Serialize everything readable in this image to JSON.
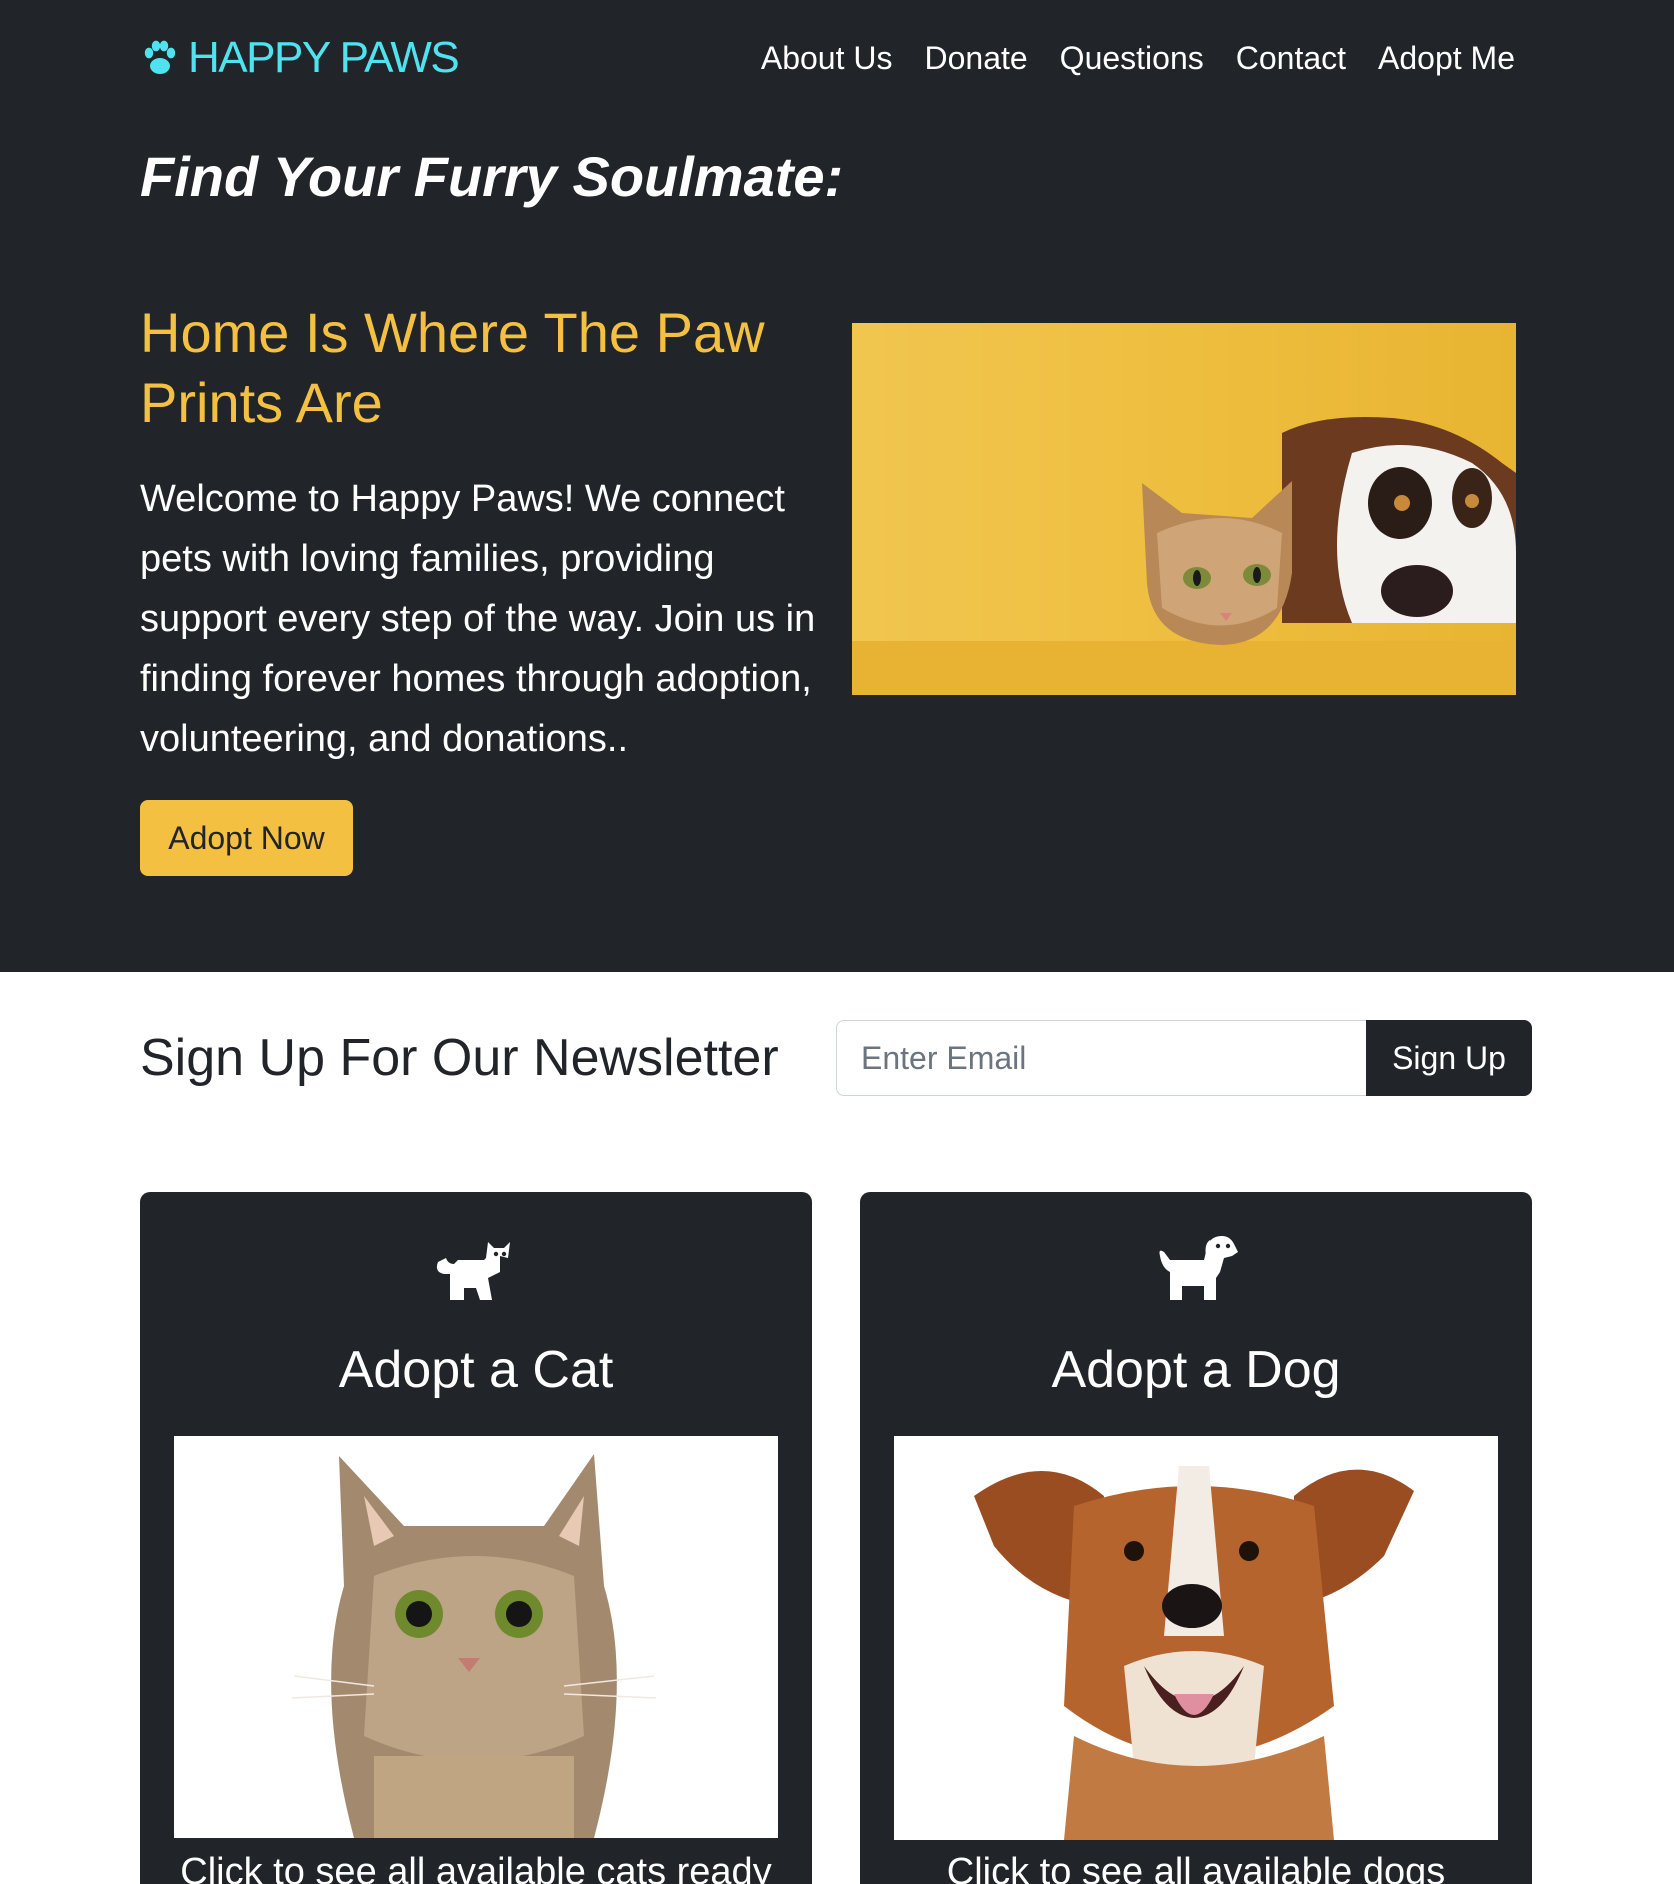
{
  "brand": {
    "name": "HAPPY PAWS",
    "icon": "paw-icon",
    "color": "#4fe3f0"
  },
  "nav": {
    "items": [
      {
        "label": "About Us"
      },
      {
        "label": "Donate"
      },
      {
        "label": "Questions"
      },
      {
        "label": "Contact"
      },
      {
        "label": "Adopt Me"
      }
    ]
  },
  "hero": {
    "title": "Find Your Furry Soulmate:",
    "subtitle": "Home Is Where The Paw Prints Are",
    "text": "Welcome to Happy Paws! We connect pets with loving families, providing support every step of the way. Join us in finding forever homes through adoption, volunteering, and donations..",
    "button_label": "Adopt Now",
    "image": "cat-and-dog-photo",
    "accent_color": "#f4c042"
  },
  "newsletter": {
    "title": "Sign Up For Our Newsletter",
    "email_placeholder": "Enter Email",
    "email_value": "",
    "button_label": "Sign Up"
  },
  "cards": [
    {
      "icon": "cat-icon",
      "title": "Adopt a Cat",
      "image": "cat-photo",
      "text": "Click to see all available cats ready"
    },
    {
      "icon": "dog-icon",
      "title": "Adopt a Dog",
      "image": "dog-photo",
      "text": "Click to see all available dogs"
    }
  ],
  "colors": {
    "dark": "#212529",
    "accent": "#f4c042",
    "brand": "#4fe3f0"
  }
}
